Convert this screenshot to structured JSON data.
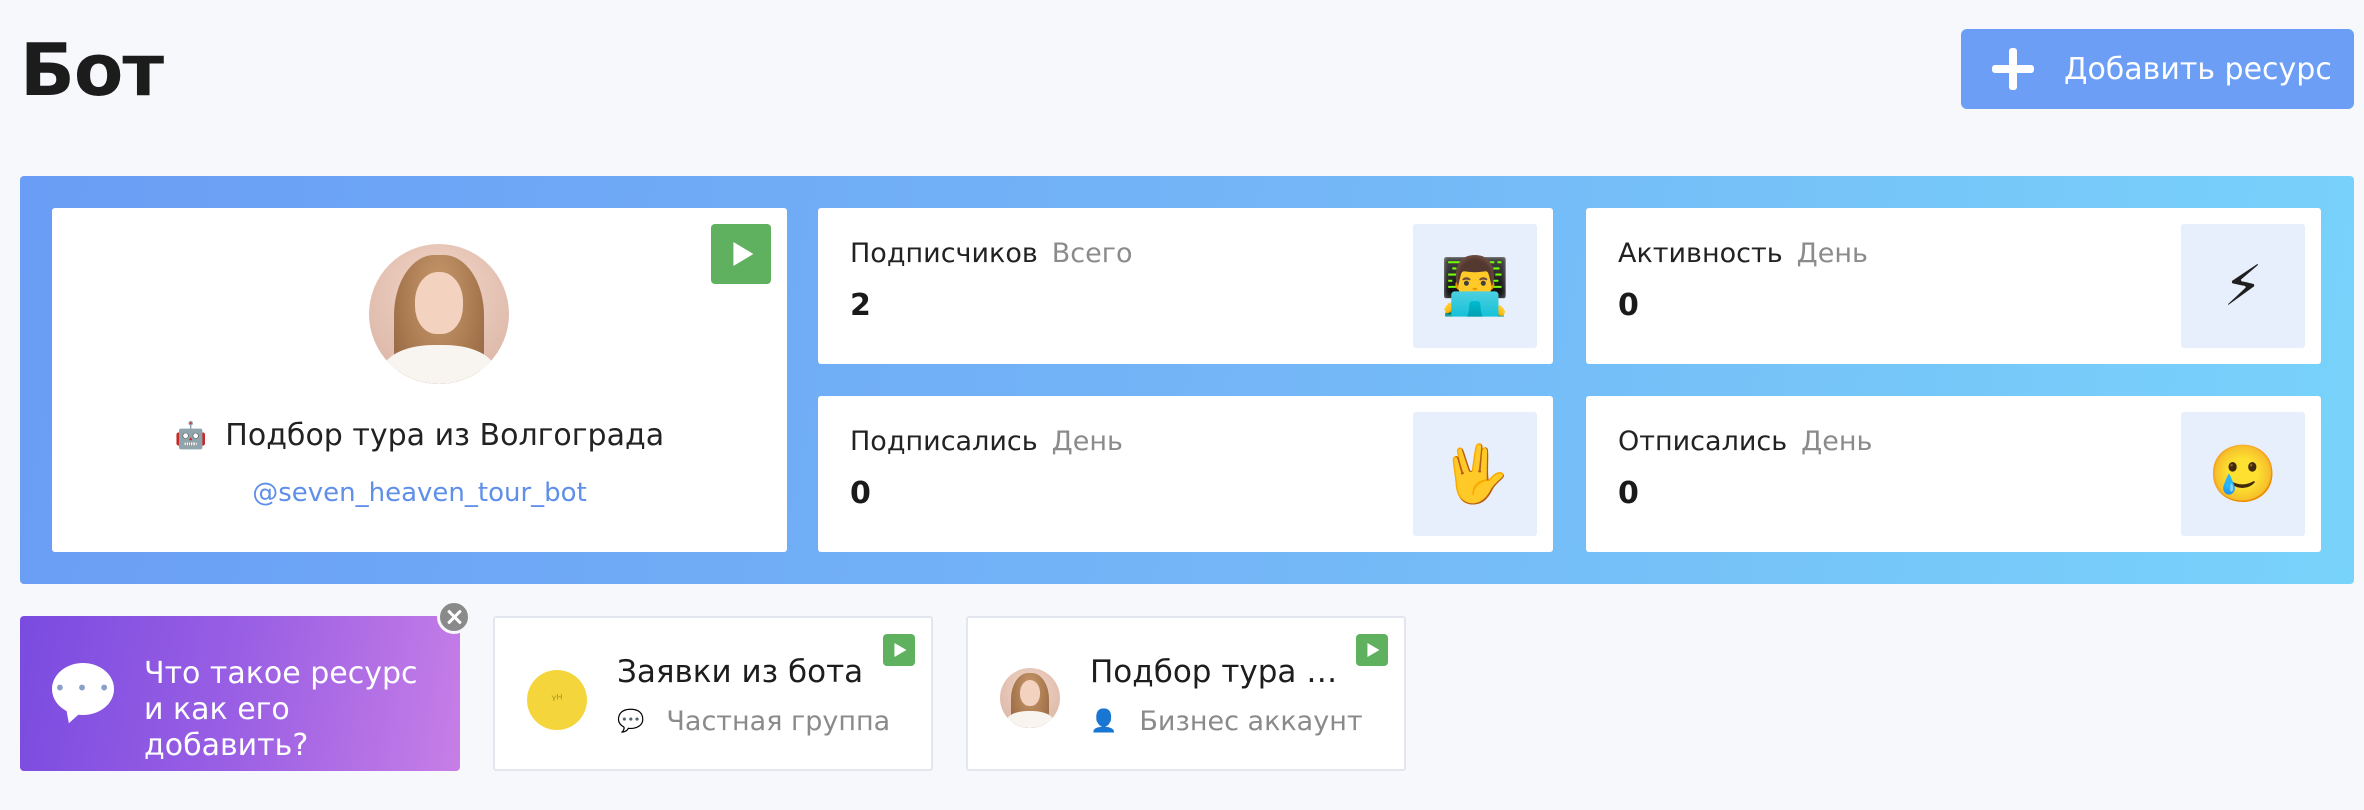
{
  "header": {
    "title": "Бот",
    "add_button_label": "Добавить ресурс"
  },
  "bot": {
    "name": "Подбор тура из Волгограда",
    "handle": "@seven_heaven_tour_bot",
    "name_icon": "robot-icon",
    "name_icon_glyph": "🤖"
  },
  "stats": [
    {
      "title": "Подписчиков",
      "period": "Всего",
      "value": "2",
      "icon": "technologist-icon",
      "glyph": "👨‍💻"
    },
    {
      "title": "Активность",
      "period": "День",
      "value": "0",
      "icon": "lightning-icon",
      "glyph": "⚡"
    },
    {
      "title": "Подписались",
      "period": "День",
      "value": "0",
      "icon": "vulcan-salute-icon",
      "glyph": "🖖"
    },
    {
      "title": "Отписались",
      "period": "День",
      "value": "0",
      "icon": "crying-face-icon",
      "glyph": "🥲"
    }
  ],
  "info_tile": {
    "text": "Что такое ресурс и как его добавить?",
    "icon": "chat-bubble-icon"
  },
  "resources": [
    {
      "name": "Заявки из бота",
      "type": "Частная группа",
      "type_icon": "speech-bubble-icon",
      "type_glyph": "💬",
      "avatar_text": "ᵞᴴ"
    },
    {
      "name": "Подбор тура …",
      "type": "Бизнес аккаунт",
      "type_icon": "person-icon",
      "type_glyph": "👤"
    }
  ],
  "colors": {
    "accent": "#6c9ef5",
    "play_green": "#5fb05f",
    "handle_blue": "#5f8fe8",
    "gradient_start": "#6a9df5",
    "gradient_end": "#78d3fa",
    "info_tile_start": "#7a4be0",
    "info_tile_end": "#c77ee6"
  }
}
